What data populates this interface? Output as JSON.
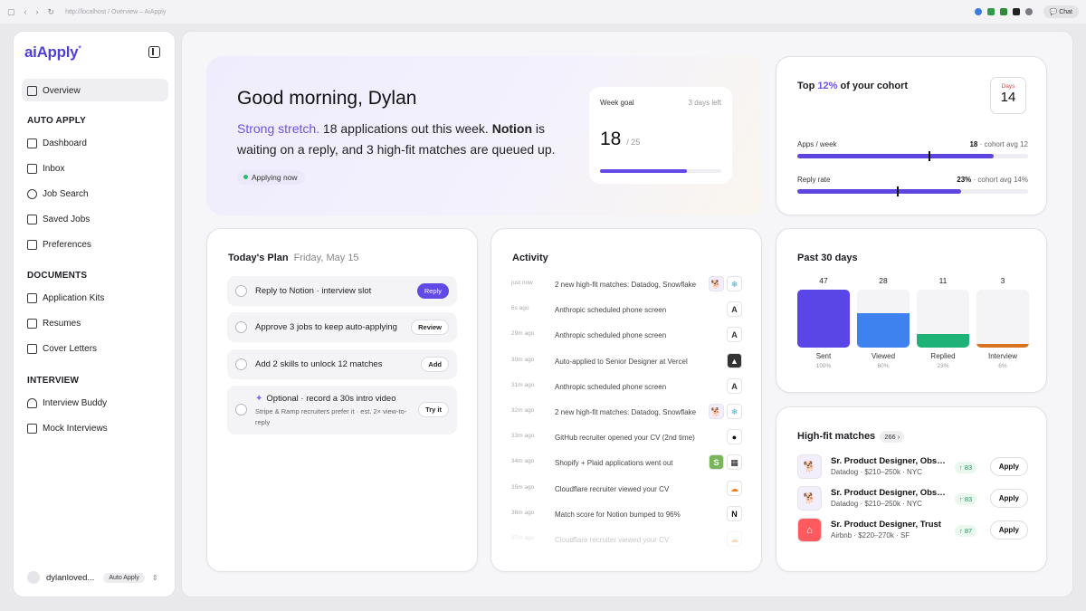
{
  "browser": {
    "url": "http://localhost / Overview – AiApply",
    "chat_label": "Chat"
  },
  "sidebar": {
    "logo": "aiApply",
    "logo_mark": "*",
    "overview": "Overview",
    "sections": [
      {
        "title": "AUTO APPLY",
        "items": [
          "Dashboard",
          "Inbox",
          "Job Search",
          "Saved Jobs",
          "Preferences"
        ]
      },
      {
        "title": "DOCUMENTS",
        "items": [
          "Application Kits",
          "Resumes",
          "Cover Letters"
        ]
      },
      {
        "title": "INTERVIEW",
        "items": [
          "Interview Buddy",
          "Mock Interviews"
        ]
      }
    ],
    "user": {
      "name": "dylanloved...",
      "badge": "Auto Apply"
    }
  },
  "hero": {
    "greeting": "Good morning, Dylan",
    "highlight": "Strong stretch.",
    "text1": " 18 applications out this week. ",
    "company": "Notion",
    "text2": " is waiting on a reply, and 3 high-fit matches are queued up.",
    "status": "Applying now",
    "goal": {
      "label": "Week goal",
      "remaining": "3 days left",
      "value": "18",
      "total": "/ 25",
      "progress": 0.72
    }
  },
  "cohort": {
    "prefix": "Top ",
    "percent": "12%",
    "suffix": " of your cohort",
    "days_label": "Days",
    "days_value": "14",
    "metrics": [
      {
        "label": "Apps / week",
        "value": "18",
        "avg": "· cohort avg 12",
        "fill": 0.85,
        "marker": 0.57
      },
      {
        "label": "Reply rate",
        "value": "23%",
        "avg": "· cohort avg 14%",
        "fill": 0.71,
        "marker": 0.43
      }
    ]
  },
  "plan": {
    "title": "Today's Plan",
    "date": "Friday, May 15",
    "tasks": [
      {
        "text": "Reply to Notion · interview slot",
        "button": "Reply"
      },
      {
        "text": "Approve 3 jobs to keep auto-applying",
        "button": "Review"
      },
      {
        "text": "Add 2 skills to unlock 12 matches",
        "button": "Add"
      },
      {
        "text": "Optional · record a 30s intro video",
        "sub": "Stripe & Ramp recruiters prefer it · est. 2× view-to-reply",
        "button": "Try it"
      }
    ]
  },
  "activity": {
    "title": "Activity",
    "items": [
      {
        "time": "just now",
        "text": "2 new high-fit matches: Datadog, Snowflake",
        "logo": "datadog",
        "logo2": "snowflake"
      },
      {
        "time": "6s ago",
        "text": "Anthropic scheduled phone screen",
        "logo": "anthropic"
      },
      {
        "time": "29m ago",
        "text": "Anthropic scheduled phone screen",
        "logo": "anthropic"
      },
      {
        "time": "30m ago",
        "text": "Auto-applied to Senior Designer at Vercel",
        "logo": "vercel"
      },
      {
        "time": "31m ago",
        "text": "Anthropic scheduled phone screen",
        "logo": "anthropic"
      },
      {
        "time": "32m ago",
        "text": "2 new high-fit matches: Datadog, Snowflake",
        "logo": "datadog",
        "logo2": "snowflake"
      },
      {
        "time": "33m ago",
        "text": "GitHub recruiter opened your CV (2nd time)",
        "logo": "github"
      },
      {
        "time": "34m ago",
        "text": "Shopify + Plaid applications went out",
        "logo": "shopify",
        "logo2": "plaid"
      },
      {
        "time": "35m ago",
        "text": "Cloudflare recruiter viewed your CV",
        "logo": "cloudflare"
      },
      {
        "time": "36m ago",
        "text": "Match score for Notion bumped to 96%",
        "logo": "notion"
      },
      {
        "time": "37m ago",
        "text": "Cloudflare recruiter viewed your CV",
        "logo": "cloudflare"
      }
    ]
  },
  "past30": {
    "title": "Past 30 days",
    "stats": [
      {
        "value": "47",
        "label": "Sent",
        "pct": "100%",
        "ratio": 1.0,
        "color": "#5a45e6"
      },
      {
        "value": "28",
        "label": "Viewed",
        "pct": "60%",
        "ratio": 0.6,
        "color": "#3d82ee"
      },
      {
        "value": "11",
        "label": "Replied",
        "pct": "23%",
        "ratio": 0.23,
        "color": "#1fb277"
      },
      {
        "value": "3",
        "label": "Interview",
        "pct": "6%",
        "ratio": 0.06,
        "color": "#d9731f"
      }
    ]
  },
  "matches": {
    "title": "High-fit matches",
    "count": "266",
    "items": [
      {
        "title": "Sr. Product Designer, Observability",
        "sub": "Datadog · $210–250k · NYC",
        "score": "↑ 83",
        "button": "Apply",
        "logo": "datadog"
      },
      {
        "title": "Sr. Product Designer, Observability",
        "sub": "Datadog · $210–250k · NYC",
        "score": "↑ 83",
        "button": "Apply",
        "logo": "datadog"
      },
      {
        "title": "Sr. Product Designer, Trust",
        "sub": "Airbnb · $220–270k · SF",
        "score": "↑ 87",
        "button": "Apply",
        "logo": "airbnb"
      }
    ]
  }
}
